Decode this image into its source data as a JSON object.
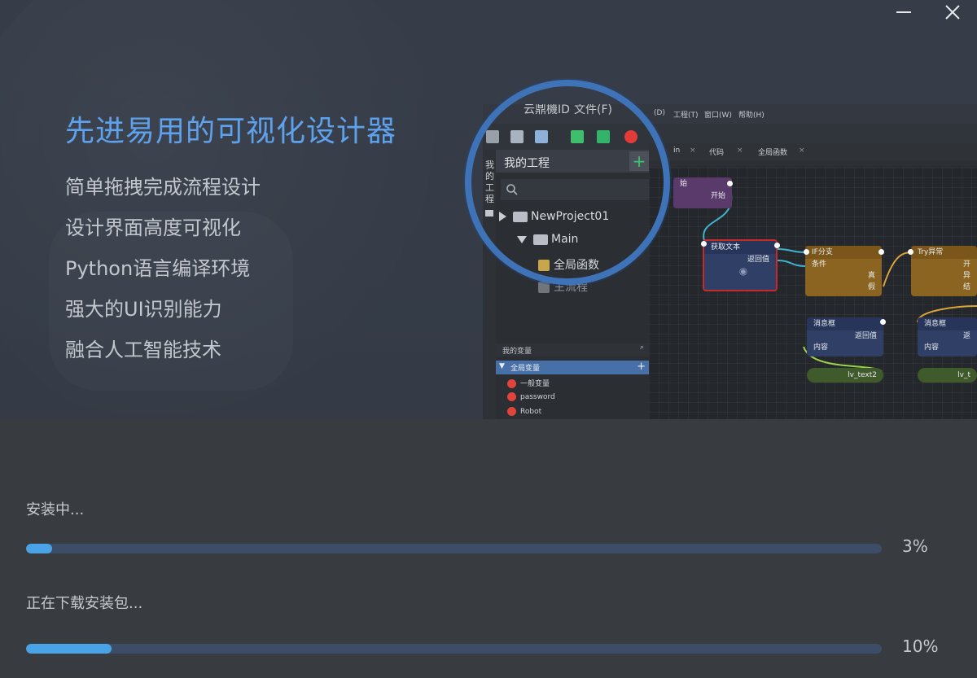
{
  "window": {
    "minimize_icon": "minimize-icon",
    "close_icon": "close-icon"
  },
  "banner": {
    "headline": "先进易用的可视化设计器",
    "features": [
      "简单拖拽完成流程设计",
      "设计界面高度可视化",
      "Python语言编译环境",
      "强大的UI识别能力",
      "融合人工智能技术"
    ],
    "preview": {
      "menu": [
        "云鼎機ID",
        "文件(F)",
        "(D)",
        "工程(T)",
        "窗口(W)",
        "帮助(H)"
      ],
      "left_tab": [
        "我",
        "的",
        "工",
        "程"
      ],
      "panel_title": "我的工程",
      "panel_add": "+",
      "tree": [
        "NewProject01",
        "Main",
        "全局函数",
        "主流程"
      ],
      "editor_tabs": [
        "in",
        "代码",
        "全局函数"
      ],
      "vars_title": "我的变量",
      "vars_group": "全局变量",
      "vars": [
        "一般变量",
        "password",
        "Robot"
      ],
      "nodes": {
        "start_title": "始",
        "start_out": "开始",
        "gettext_title": "获取文本",
        "gettext_ret": "返回值",
        "if_title": "IF分支",
        "if_cond": "条件",
        "if_true": "真",
        "if_false": "假",
        "try_title": "Try异常",
        "try_r1": "开",
        "try_r2": "异",
        "try_r3": "结",
        "msg_title": "消息框",
        "msg_ret": "返回值",
        "msg_content": "内容",
        "var1": "lv_text2",
        "msg2_title": "消息框",
        "msg2_ret": "返",
        "msg2_content": "内容",
        "var2": "lv_t"
      },
      "colors": {
        "lens_ring": "#3f73b8",
        "node_start": "#5a3a6b",
        "node_blue": "#2f3f66",
        "node_orange": "#8a6420",
        "node_var": "#3f5a2b",
        "node_selected_border": "#c8292c"
      }
    }
  },
  "install": {
    "status_label": "安装中...",
    "status_percent_text": "3%",
    "status_progress": 0.03,
    "download_label": "正在下载安装包...",
    "download_percent_text": "10%",
    "download_progress": 0.1,
    "colors": {
      "fill": "#4aa3e6",
      "track": "#3e4d67"
    }
  }
}
